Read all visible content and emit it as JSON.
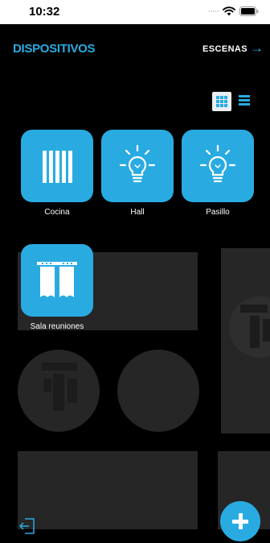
{
  "status_bar": {
    "time": "10:32",
    "signal_icon": "signal-dots-icon",
    "wifi_icon": "wifi-icon",
    "battery_icon": "battery-icon"
  },
  "header": {
    "title": "DISPOSITIVOS",
    "scenes_label": "ESCENAS",
    "scenes_icon": "arrow-right-icon"
  },
  "view_toggle": {
    "active": "grid",
    "grid_icon": "grid-view-icon",
    "list_icon": "list-view-icon"
  },
  "devices": [
    {
      "label": "Cocina",
      "icon": "blinds-icon"
    },
    {
      "label": "Hall",
      "icon": "lightbulb-icon"
    },
    {
      "label": "Pasillo",
      "icon": "lightbulb-icon"
    },
    {
      "label": "Sala reuniones",
      "icon": "curtains-icon"
    }
  ],
  "footer": {
    "exit_icon": "logout-icon",
    "add_icon": "plus-icon"
  },
  "colors": {
    "accent": "#29abe2",
    "background": "#000000",
    "placeholder": "#262626"
  }
}
